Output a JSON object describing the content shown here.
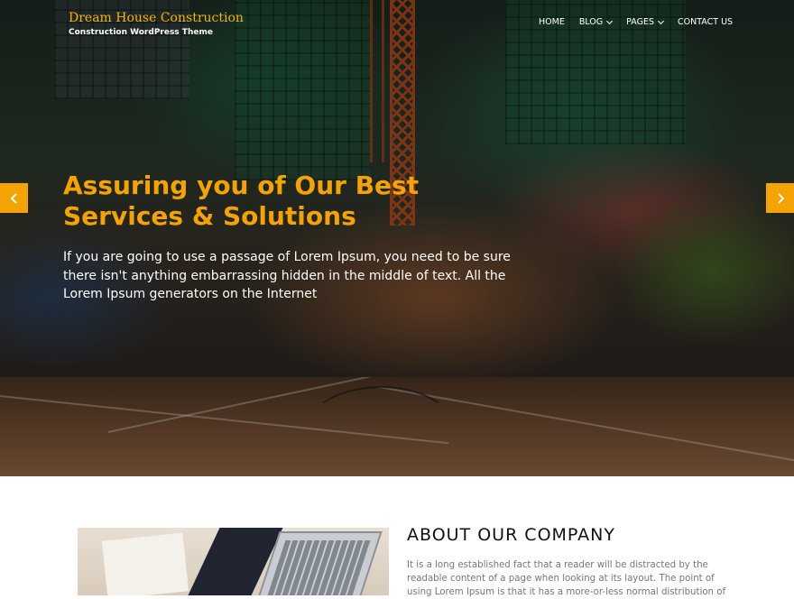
{
  "header": {
    "site_title": "Dream House Construction",
    "tagline": "Construction WordPress Theme"
  },
  "nav": {
    "items": [
      {
        "label": "HOME",
        "has_dropdown": false
      },
      {
        "label": "BLOG",
        "has_dropdown": true
      },
      {
        "label": "PAGES",
        "has_dropdown": true
      },
      {
        "label": "CONTACT US",
        "has_dropdown": false
      }
    ]
  },
  "slider": {
    "heading": "Assuring you of Our Best Services & Solutions",
    "text": "If you are going to use a passage of Lorem Ipsum, you need to be sure there isn't anything embarrassing hidden in the middle of text. All the Lorem Ipsum generators on the Internet",
    "prev_icon": "chevron-left-icon",
    "next_icon": "chevron-right-icon"
  },
  "about": {
    "title": "ABOUT OUR COMPANY",
    "text": "It is a long established fact that a reader will be distracted by the readable content of a page when looking at its layout. The point of using Lorem Ipsum is that it has a more-or-less normal distribution of"
  },
  "colors": {
    "accent": "#f5a300",
    "title_gold": "#f5b400",
    "nav_text": "#ffffff",
    "body_text": "#777777",
    "heading_dark": "#111111"
  }
}
